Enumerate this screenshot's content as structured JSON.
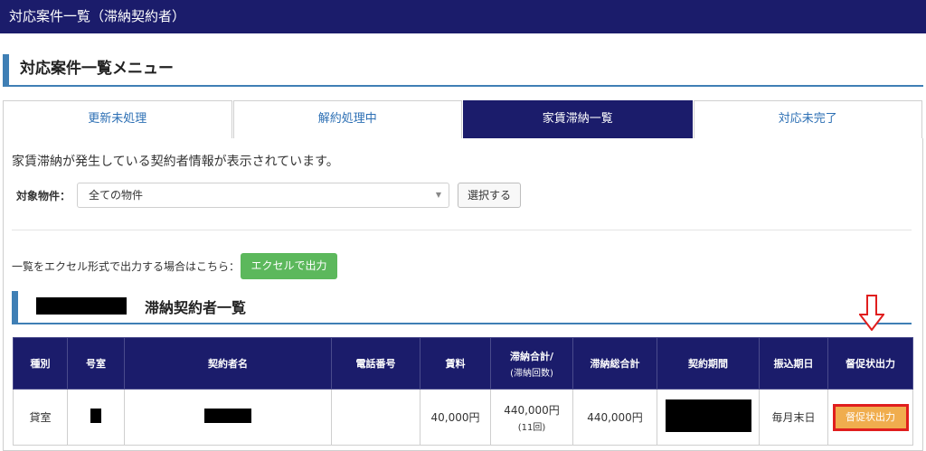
{
  "header": {
    "title": "対応案件一覧（滞納契約者）"
  },
  "menu_heading": "対応案件一覧メニュー",
  "tabs": [
    {
      "label": "更新未処理",
      "active": false
    },
    {
      "label": "解約処理中",
      "active": false
    },
    {
      "label": "家賃滞納一覧",
      "active": true
    },
    {
      "label": "対応未完了",
      "active": false
    }
  ],
  "description": "家賃滞納が発生している契約者情報が表示されています。",
  "filter": {
    "label": "対象物件：",
    "selected": "全ての物件",
    "submit_label": "選択する"
  },
  "excel": {
    "text": "一覧をエクセル形式で出力する場合はこちら：",
    "button_label": "エクセルで出力"
  },
  "list_title": "滞納契約者一覧",
  "table": {
    "headers": {
      "type": "種別",
      "room": "号室",
      "contractor": "契約者名",
      "phone": "電話番号",
      "rent": "賃料",
      "arrears_total": "滞納合計/",
      "arrears_total_sub": "(滞納回数)",
      "arrears_grand_total": "滞納総合計",
      "period": "契約期間",
      "transfer_date": "振込期日",
      "notice_output": "督促状出力"
    },
    "rows": [
      {
        "type": "貸室",
        "rent": "40,000円",
        "arrears_total": "440,000円",
        "arrears_count": "(11回)",
        "arrears_grand_total": "440,000円",
        "transfer_date": "毎月末日",
        "notice_button": "督促状出力"
      }
    ]
  },
  "colors": {
    "navy": "#1b1c6b",
    "accent_blue": "#3f7fb5",
    "excel_green": "#5cb85c",
    "notice_orange": "#f0ad4e",
    "highlight_red": "#e01e1e"
  }
}
